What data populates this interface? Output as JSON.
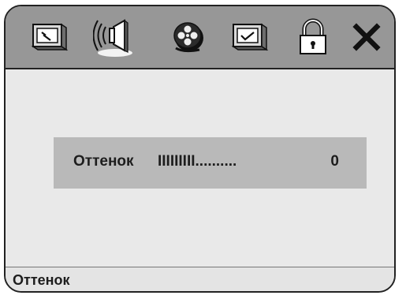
{
  "toolbar": {
    "icons": [
      {
        "name": "settings-wrench-icon"
      },
      {
        "name": "speaker-audio-icon"
      },
      {
        "name": "film-reel-video-icon"
      },
      {
        "name": "checkbox-preference-icon"
      },
      {
        "name": "padlock-icon"
      },
      {
        "name": "close-icon"
      }
    ],
    "selected_index": 1
  },
  "menu": {
    "item_label": "Оттенок",
    "item_bar": "IIIIIIIII..........",
    "item_value": "0"
  },
  "status": {
    "text": "Оттенок"
  },
  "colors": {
    "toolbar_bg": "#979797",
    "content_bg": "#e9e9e9",
    "row_bg": "#b9b9b9",
    "frame": "#222222"
  }
}
